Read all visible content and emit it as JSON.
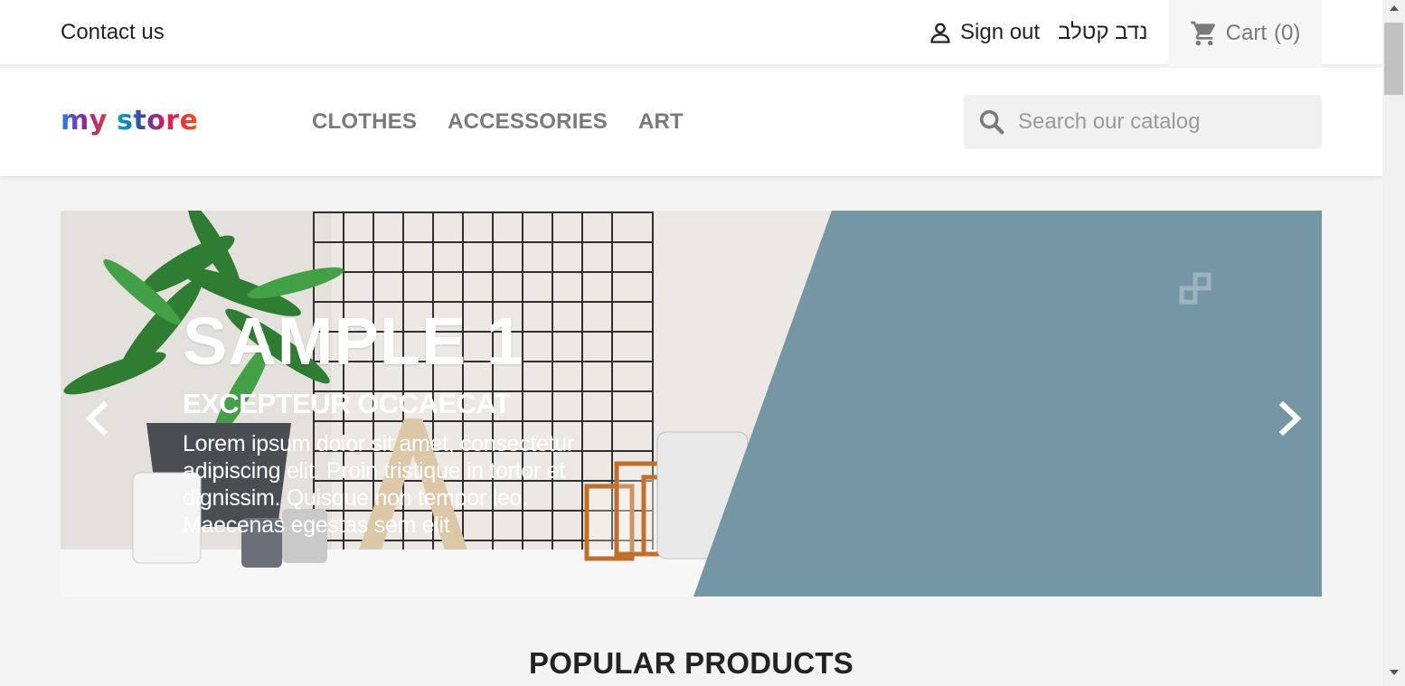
{
  "topbar": {
    "contact_label": "Contact us",
    "signout_label": "Sign out",
    "username": "נדב קטלב",
    "cart_label": "Cart",
    "cart_count": "(0)"
  },
  "header": {
    "logo_text": [
      "my",
      " ",
      "store"
    ],
    "nav": [
      {
        "label": "CLOTHES"
      },
      {
        "label": "ACCESSORIES"
      },
      {
        "label": "ART"
      }
    ],
    "search_placeholder": "Search our catalog"
  },
  "slider": {
    "title": "SAMPLE 1",
    "subtitle": "EXCEPTEUR OCCAECAT",
    "text": "Lorem ipsum dolor sit amet, consectetur adipiscing elit. Proin tristique in tortor et dignissim. Quisque non tempor leo. Maecenas egestas sem elit",
    "accent_color": "#7596a4"
  },
  "sections": {
    "popular_title": "POPULAR PRODUCTS"
  },
  "icons": {
    "user": "user-icon",
    "cart": "cart-icon",
    "search": "search-icon",
    "prev": "chevron-left-icon",
    "next": "chevron-right-icon"
  }
}
